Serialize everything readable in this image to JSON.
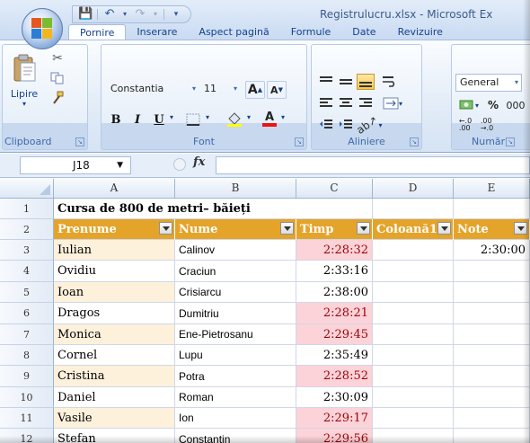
{
  "window": {
    "title": "Registrulucru.xlsx - Microsoft Ex"
  },
  "quick_access": [
    "save-icon",
    "undo-icon",
    "redo-icon",
    "customize-icon"
  ],
  "tabs": [
    "Pornire",
    "Inserare",
    "Aspect pagină",
    "Formule",
    "Date",
    "Revizuire"
  ],
  "ribbon": {
    "clipboard": {
      "label": "Clipboard",
      "paste": "Lipire"
    },
    "font": {
      "label": "Font",
      "family": "Constantia",
      "size": "11",
      "bold": "B",
      "italic": "I",
      "underline": "U",
      "grow": "A",
      "shrink": "A"
    },
    "alignment": {
      "label": "Aliniere"
    },
    "number": {
      "label": "Număr",
      "format": "General",
      "percent": "%",
      "thousands": "000"
    }
  },
  "formula_bar": {
    "cell_ref": "J18",
    "fx": "fx",
    "value": ""
  },
  "columns": [
    "A",
    "B",
    "C",
    "D",
    "E"
  ],
  "rows": [
    "1",
    "2",
    "3",
    "4",
    "5",
    "6",
    "7",
    "8",
    "9",
    "10",
    "11",
    "12"
  ],
  "sheet": {
    "title": "Cursa de 800 de metri– băieți",
    "headers": [
      "Prenume",
      "Nume",
      "Timp",
      "Coloană1",
      "Note"
    ],
    "data": [
      {
        "first": "Iulian",
        "last": "Calinov",
        "time": "2:28:32",
        "col1": "",
        "note": "2:30:00"
      },
      {
        "first": "Ovidiu",
        "last": "Craciun",
        "time": "2:33:16",
        "col1": "",
        "note": ""
      },
      {
        "first": "Ioan",
        "last": "Crisiarcu",
        "time": "2:38:00",
        "col1": "",
        "note": ""
      },
      {
        "first": "Dragos",
        "last": "Dumitriu",
        "time": "2:28:21",
        "col1": "",
        "note": ""
      },
      {
        "first": "Monica",
        "last": "Ene-Pietrosanu",
        "time": "2:29:45",
        "col1": "",
        "note": ""
      },
      {
        "first": "Cornel",
        "last": "Lupu",
        "time": "2:35:49",
        "col1": "",
        "note": ""
      },
      {
        "first": "Cristina",
        "last": "Potra",
        "time": "2:28:52",
        "col1": "",
        "note": ""
      },
      {
        "first": "Daniel",
        "last": "Roman",
        "time": "2:30:09",
        "col1": "",
        "note": ""
      },
      {
        "first": "Vasile",
        "last": "Ion",
        "time": "2:29:17",
        "col1": "",
        "note": ""
      },
      {
        "first": "Ștefan",
        "last": "Constantin",
        "time": "2:29:56",
        "col1": "",
        "note": ""
      }
    ]
  },
  "colors": {
    "header_fill": "#e4a42a",
    "band_fill": "#fdf1dc",
    "highlight_fill": "#fcd3d8",
    "highlight_text": "#9c0006"
  }
}
